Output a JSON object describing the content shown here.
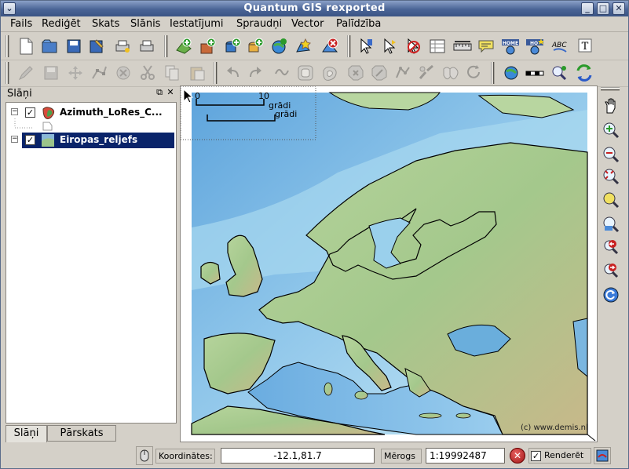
{
  "window": {
    "title": "Quantum GIS rexported"
  },
  "menu": [
    "Fails",
    "Rediģēt",
    "Skats",
    "Slānis",
    "Iestatījumi",
    "Spraudņi",
    "Vector",
    "Palīdzība"
  ],
  "toolbar1": [
    "new-project-icon",
    "open-project-icon",
    "save-project-icon",
    "save-as-icon",
    "print-composer-icon",
    "print-icon",
    "add-vector-layer-icon",
    "add-raster-layer-icon",
    "add-postgis-layer-icon",
    "new-vector-layer-icon",
    "add-wms-layer-icon",
    "add-wfs-layer-icon",
    "remove-layer-icon",
    "identify-icon",
    "select-icon",
    "deselect-icon",
    "attribute-table-icon",
    "measure-line-icon",
    "map-tips-icon",
    "home-bookmark-icon",
    "new-bookmark-icon",
    "label-icon",
    "text-annotation-icon"
  ],
  "toolbar2": [
    "toggle-editing-icon",
    "save-edits-icon",
    "move-feature-icon",
    "node-tool-icon",
    "delete-selected-icon",
    "cut-features-icon",
    "copy-features-icon",
    "paste-features-icon",
    "undo-icon",
    "redo-icon",
    "simplify-icon",
    "add-ring-icon",
    "add-island-icon",
    "delete-ring-icon",
    "delete-part-icon",
    "reshape-icon",
    "split-icon",
    "merge-icon",
    "rotate-icon",
    "georeferencer-icon",
    "scalebar-icon",
    "gps-icon",
    "coordinate-capture-icon"
  ],
  "layers_panel": {
    "title": "Slāņi",
    "layers": [
      {
        "name": "Azimuth_LoRes_C...",
        "checked": true
      },
      {
        "name": "Eiropas_reljefs",
        "checked": true,
        "selected": true
      }
    ],
    "tabs": [
      "Slāņi",
      "Pārskats"
    ]
  },
  "map": {
    "scalebar": {
      "start": "0",
      "end": "10",
      "unit": "grādi",
      "unit2": "grādi"
    },
    "credit": "(c) www.demis.nl"
  },
  "right_toolbar": [
    "pan-icon",
    "zoom-in-icon",
    "zoom-out-icon",
    "zoom-full-icon",
    "zoom-to-selection-icon",
    "zoom-to-layer-icon",
    "zoom-last-icon",
    "zoom-next-icon",
    "refresh-icon"
  ],
  "status": {
    "coord_label": "Koordinātes:",
    "coord_value": "-12.1,81.7",
    "scale_label": "Mērogs",
    "scale_value": "1:19992487",
    "render_label": "Renderēt",
    "render_checked": true
  },
  "colors": {
    "title_bar": "#4a6496",
    "selected_row": "#0a246a",
    "sea_deep": "#7fb6e6",
    "sea_light": "#c4e6f4",
    "land": "#9cc48a"
  }
}
